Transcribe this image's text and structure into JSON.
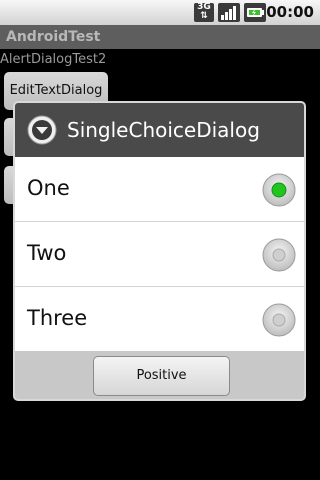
{
  "status_bar": {
    "network_type": "3G",
    "time": "00:00",
    "icons": [
      "3g-icon",
      "signal-icon",
      "battery-charging-icon"
    ]
  },
  "app": {
    "title": "AndroidTest",
    "activity_label": "AlertDialogTest2"
  },
  "background": {
    "buttons": [
      {
        "label": "EditTextDialog"
      }
    ]
  },
  "dialog": {
    "title": "SingleChoiceDialog",
    "icon": "dialog-info-icon",
    "options": [
      {
        "label": "One",
        "selected": true
      },
      {
        "label": "Two",
        "selected": false
      },
      {
        "label": "Three",
        "selected": false
      }
    ],
    "positive_button": "Positive"
  },
  "colors": {
    "radio_selected": "#22c51f",
    "dialog_header": "#4a4a4a",
    "button_bar": "#c8c8c8"
  }
}
